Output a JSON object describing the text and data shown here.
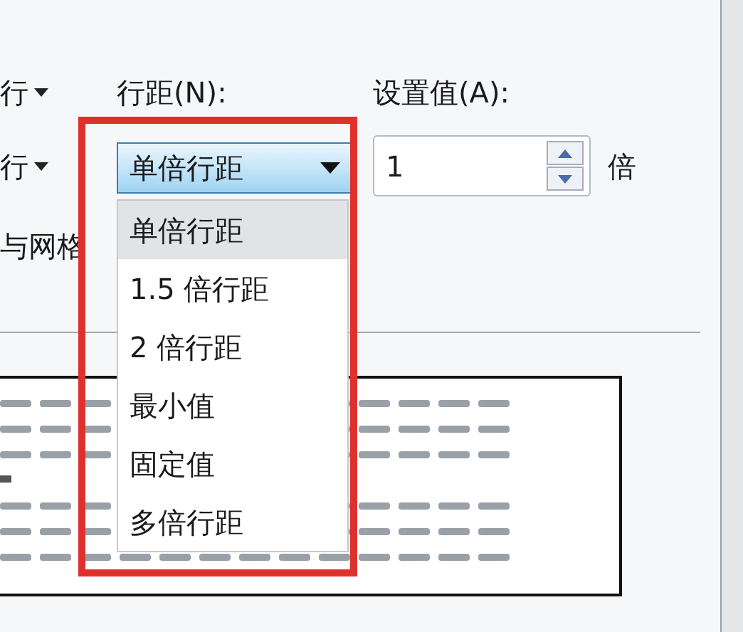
{
  "left_labels": [
    {
      "text": "行"
    },
    {
      "text": "行"
    }
  ],
  "line_spacing": {
    "label": "行距(N):",
    "value": "单倍行距",
    "expanded": true,
    "options": [
      {
        "label": "单倍行距",
        "selected": true
      },
      {
        "label": "1.5 倍行距",
        "selected": false
      },
      {
        "label": "2 倍行距",
        "selected": false
      },
      {
        "label": "最小值",
        "selected": false
      },
      {
        "label": "固定值",
        "selected": false
      },
      {
        "label": "多倍行距",
        "selected": false
      }
    ]
  },
  "setting": {
    "label": "设置值(A):",
    "value": "1",
    "unit": "倍"
  },
  "snap_label": "与网格"
}
